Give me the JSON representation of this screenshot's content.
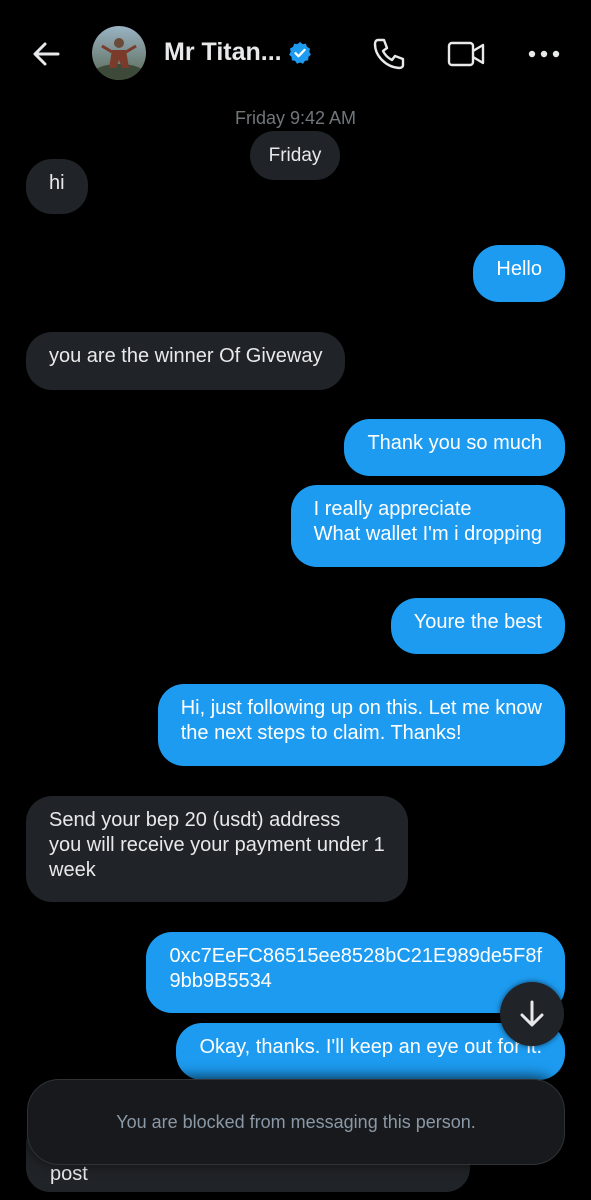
{
  "header": {
    "contact_name": "Mr Titan...",
    "icons": [
      "back-arrow-icon",
      "verified-badge-icon",
      "phone-icon",
      "video-camera-icon",
      "more-dots-icon"
    ],
    "accent_color": "#1d9bf0"
  },
  "conversation": {
    "timestamp": "Friday 9:42 AM",
    "day_pill": "Friday",
    "messages": [
      {
        "dir": "in",
        "text": "hi"
      },
      {
        "dir": "out",
        "text": "Hello"
      },
      {
        "dir": "in",
        "text": "you are the winner Of Giveway"
      },
      {
        "dir": "out",
        "text": "Thank you so much"
      },
      {
        "dir": "out",
        "text": "I really appreciate\nWhat wallet I'm i dropping"
      },
      {
        "dir": "out",
        "text": "Youre the best"
      },
      {
        "dir": "out",
        "text": "Hi, just following up on this. Let me know\nthe next steps to claim. Thanks!"
      },
      {
        "dir": "in",
        "text": "Send your bep 20 (usdt)  address\nyou will receive your payment under 1\nweek"
      },
      {
        "dir": "out",
        "text": "0xc7EeFC86515ee8528bC21E989de5F8f\n9bb9B5534"
      },
      {
        "dir": "out",
        "text": "Okay, thanks. I'll keep an eye out for it."
      },
      {
        "dir": "in",
        "text": "post"
      }
    ]
  },
  "blocked_notice": "You are blocked from messaging this person."
}
